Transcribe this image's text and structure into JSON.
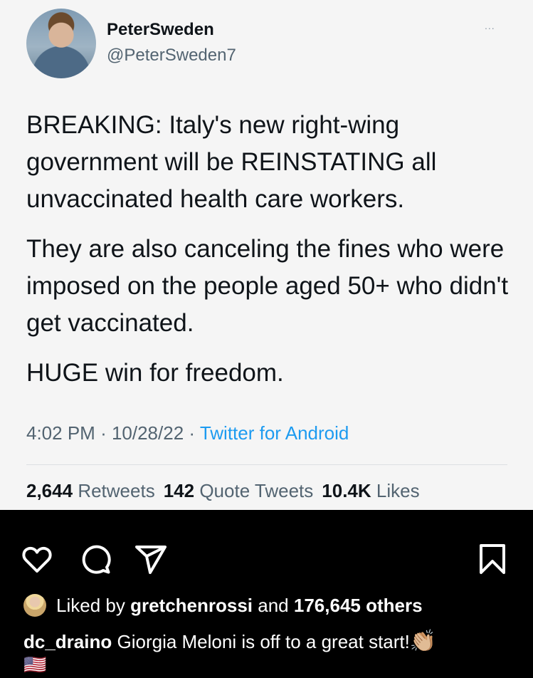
{
  "tweet": {
    "display_name": "PeterSweden",
    "handle": "@PeterSweden7",
    "more_icon": "...",
    "paragraphs": [
      "BREAKING: Italy's new right-wing government will be REINSTATING all unvaccinated health care workers.",
      "They are also canceling the fines who were imposed on the people aged 50+ who didn't get vaccinated.",
      "HUGE win for freedom."
    ],
    "time": "4:02 PM",
    "date": "10/28/22",
    "source": "Twitter for Android",
    "retweets_count": "2,644",
    "retweets_label": "Retweets",
    "quote_count": "142",
    "quote_label": "Quote Tweets",
    "likes_count": "10.4K",
    "likes_label": "Likes",
    "colors": {
      "link": "#1d9bf0",
      "muted": "#536471",
      "text": "#0f1419",
      "card_bg": "#f5f5f5"
    }
  },
  "post": {
    "actions": [
      "heart-icon",
      "comment-icon",
      "share-icon",
      "bookmark-icon"
    ],
    "liked_by_prefix": "Liked by",
    "liked_by_user": "gretchenrossi",
    "liked_by_and": "and",
    "liked_by_others": "176,645 others",
    "caption_user": "dc_draino",
    "caption_text": "Giorgia Meloni is off to a great start!",
    "caption_emoji": "👏🏼",
    "flag_emoji": "🇺🇸",
    "colors": {
      "background": "#000000",
      "text": "#ffffff"
    }
  }
}
